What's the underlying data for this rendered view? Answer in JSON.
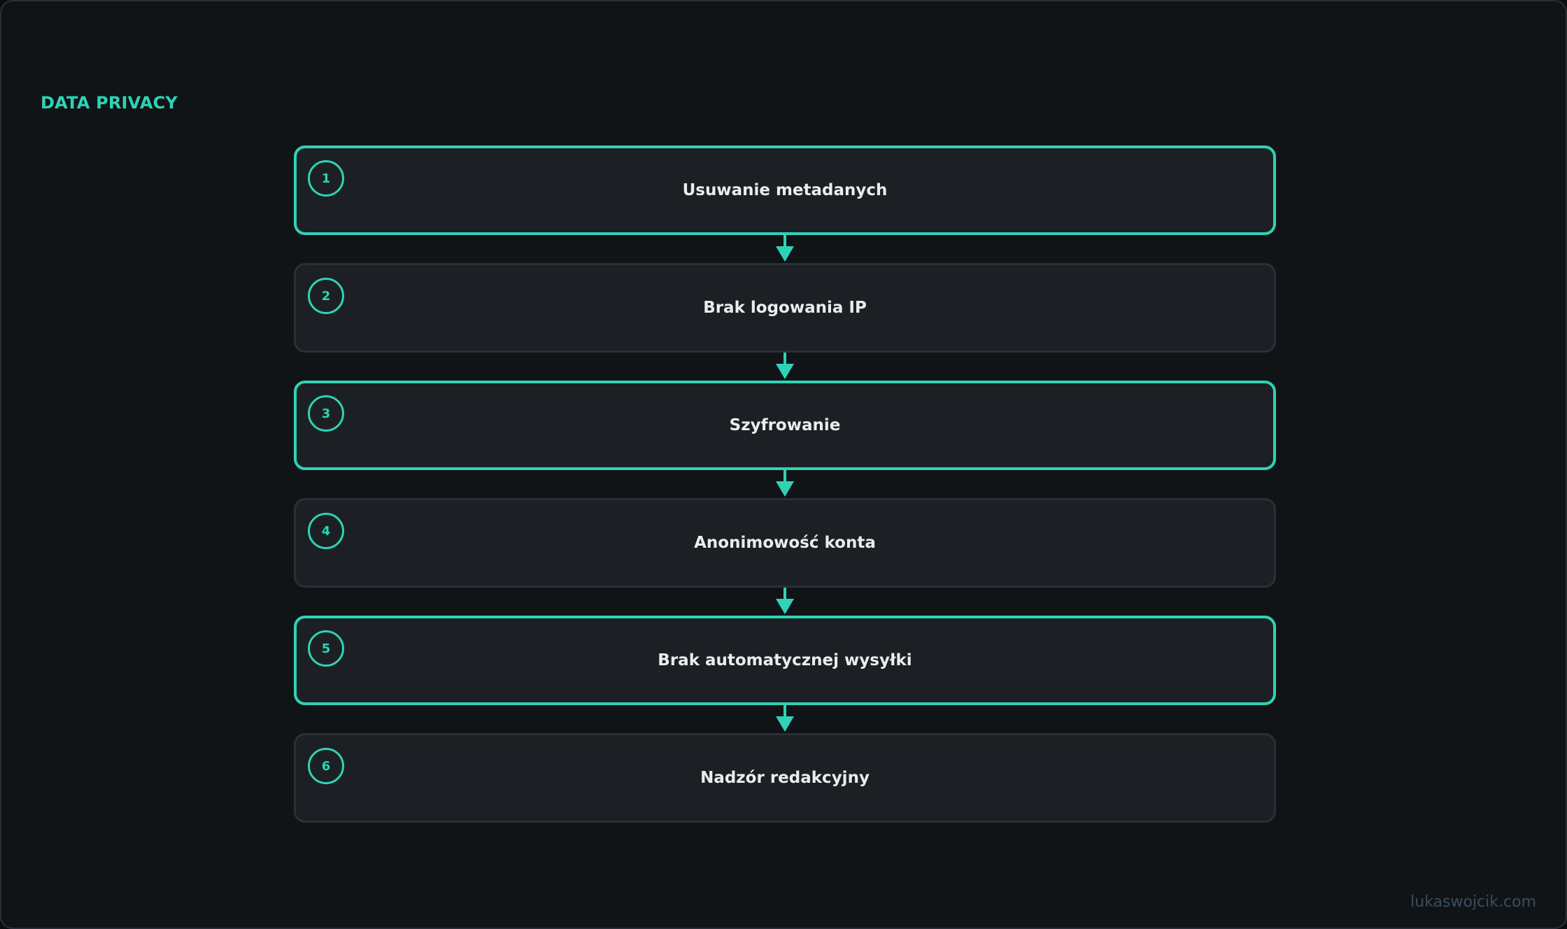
{
  "section_title": "DATA PRIVACY",
  "accent_color": "#2ed3b7",
  "steps": [
    {
      "number": "1",
      "label": "Usuwanie metadanych",
      "highlighted": true
    },
    {
      "number": "2",
      "label": "Brak logowania IP",
      "highlighted": false
    },
    {
      "number": "3",
      "label": "Szyfrowanie",
      "highlighted": true
    },
    {
      "number": "4",
      "label": "Anonimowość konta",
      "highlighted": false
    },
    {
      "number": "5",
      "label": "Brak automatycznej wysyłki",
      "highlighted": true
    },
    {
      "number": "6",
      "label": "Nadzór redakcyjny",
      "highlighted": false
    }
  ],
  "connector_icon": "arrow-down-icon",
  "watermark": "lukaswojcik.com"
}
